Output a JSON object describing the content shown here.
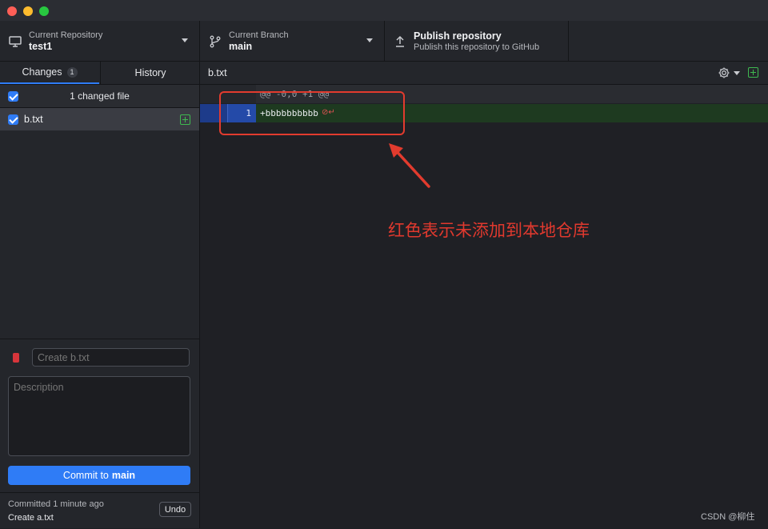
{
  "toolbar": {
    "repository": {
      "label": "Current Repository",
      "value": "test1"
    },
    "branch": {
      "label": "Current Branch",
      "value": "main"
    },
    "publish": {
      "label": "Publish repository",
      "sublabel": "Publish this repository to GitHub"
    }
  },
  "sidebar": {
    "tabs": [
      {
        "label": "Changes",
        "badge": "1",
        "active": true
      },
      {
        "label": "History",
        "active": false
      }
    ],
    "changes_header": "1 changed file",
    "files": [
      {
        "name": "b.txt",
        "status": "added",
        "checked": true
      }
    ],
    "commit": {
      "summary_placeholder": "Create b.txt",
      "description_placeholder": "Description",
      "button_prefix": "Commit to",
      "button_branch": "main"
    },
    "last_commit": {
      "time": "Committed 1 minute ago",
      "message": "Create a.txt",
      "undo_label": "Undo"
    }
  },
  "diff": {
    "file": "b.txt",
    "hunk_header": "@@ -0,0 +1 @@",
    "lines": [
      {
        "number": "1",
        "text": "+bbbbbbbbbb",
        "type": "added"
      }
    ],
    "no_newline_marker": "⊘↵"
  },
  "annotation": {
    "text": "红色表示未添加到本地仓库",
    "color": "#e0392e"
  },
  "watermark": "CSDN @柳住",
  "colors": {
    "accent": "#2f7cf6",
    "added": "#3fb950",
    "annotation": "#e23b2e"
  }
}
